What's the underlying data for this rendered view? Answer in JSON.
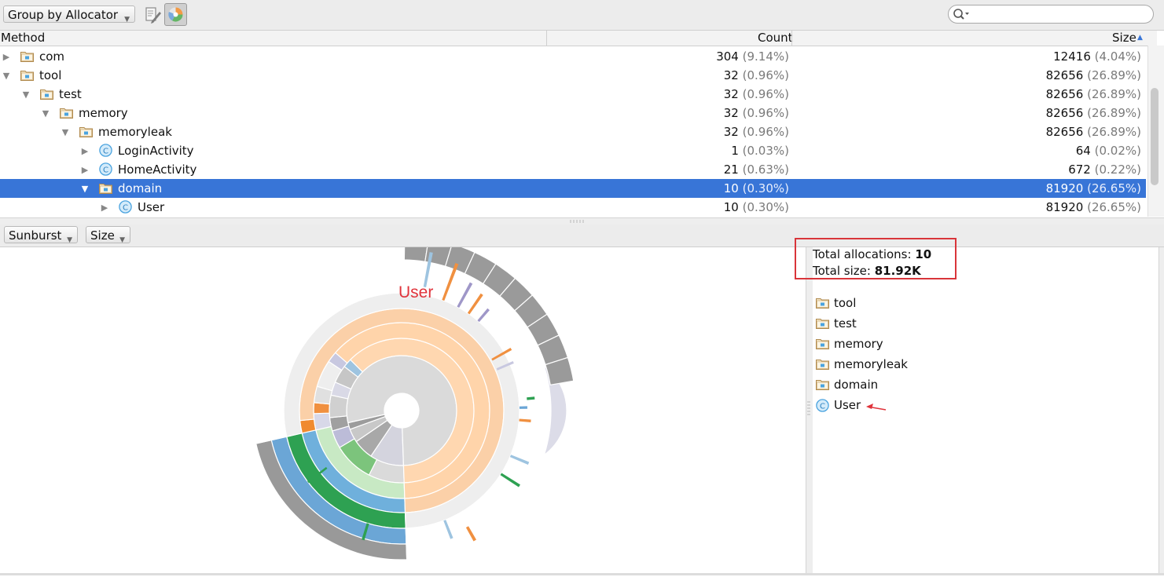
{
  "toolbar": {
    "group_by": "Group by Allocator",
    "edit_icon": "edit-filter-icon",
    "chart_toggle_icon": "pie-chart-icon",
    "search_placeholder": "",
    "search_icon": "search-icon"
  },
  "table": {
    "columns": [
      "Method",
      "Count",
      "Size"
    ],
    "sort_indicator": "▲",
    "rows": [
      {
        "name": "com",
        "type": "package",
        "expanded": false,
        "depth": 0,
        "count": "304",
        "count_pct": "(9.14%)",
        "size": "12416",
        "size_pct": "(4.04%)"
      },
      {
        "name": "tool",
        "type": "package",
        "expanded": true,
        "depth": 0,
        "count": "32",
        "count_pct": "(0.96%)",
        "size": "82656",
        "size_pct": "(26.89%)"
      },
      {
        "name": "test",
        "type": "package",
        "expanded": true,
        "depth": 1,
        "count": "32",
        "count_pct": "(0.96%)",
        "size": "82656",
        "size_pct": "(26.89%)"
      },
      {
        "name": "memory",
        "type": "package",
        "expanded": true,
        "depth": 2,
        "count": "32",
        "count_pct": "(0.96%)",
        "size": "82656",
        "size_pct": "(26.89%)"
      },
      {
        "name": "memoryleak",
        "type": "package",
        "expanded": true,
        "depth": 3,
        "count": "32",
        "count_pct": "(0.96%)",
        "size": "82656",
        "size_pct": "(26.89%)"
      },
      {
        "name": "LoginActivity",
        "type": "class",
        "expanded": false,
        "depth": 4,
        "count": "1",
        "count_pct": "(0.03%)",
        "size": "64",
        "size_pct": "(0.02%)"
      },
      {
        "name": "HomeActivity",
        "type": "class",
        "expanded": false,
        "depth": 4,
        "count": "21",
        "count_pct": "(0.63%)",
        "size": "672",
        "size_pct": "(0.22%)"
      },
      {
        "name": "domain",
        "type": "package",
        "expanded": true,
        "depth": 4,
        "count": "10",
        "count_pct": "(0.30%)",
        "size": "81920",
        "size_pct": "(26.65%)",
        "selected": true
      },
      {
        "name": "User",
        "type": "class",
        "expanded": false,
        "depth": 5,
        "count": "10",
        "count_pct": "(0.30%)",
        "size": "81920",
        "size_pct": "(26.65%)"
      }
    ]
  },
  "chart_toolbar": {
    "chart_type": "Sunburst",
    "metric": "Size"
  },
  "sunburst": {
    "hover_label": "User",
    "rings": [
      {
        "segments": [
          {
            "value": 100,
            "color": "#dcdce8"
          }
        ]
      },
      {
        "segments": [
          {
            "value": 10,
            "color": "#d4d4de"
          },
          {
            "value": 6,
            "color": "#a8a8a8"
          },
          {
            "value": 4,
            "color": "#c8c8c8"
          },
          {
            "value": 2,
            "color": "#9c9c9c"
          },
          {
            "value": 78,
            "color": "#dadada"
          }
        ]
      },
      {
        "segments": [
          {
            "value": 8,
            "color": "#dadada"
          },
          {
            "value": 9,
            "color": "#7cc47c"
          },
          {
            "value": 4,
            "color": "#bcbcd8"
          },
          {
            "value": 3,
            "color": "#a0a0a0"
          },
          {
            "value": 5,
            "color": "#d0d0d0"
          },
          {
            "value": 3,
            "color": "#d9d9e6"
          },
          {
            "value": 4,
            "color": "#c6c6c6"
          },
          {
            "value": 2,
            "color": "#9ec4e0"
          },
          {
            "value": 62,
            "color": "#ffd7b0"
          }
        ]
      },
      {
        "segments": [
          {
            "value": 22,
            "color": "#c8e9c4"
          },
          {
            "value": 3,
            "color": "#d8d8e8"
          },
          {
            "value": 2,
            "color": "#f09040"
          },
          {
            "value": 3,
            "color": "#e0e0e0"
          },
          {
            "value": 5,
            "color": "#eeeeee"
          },
          {
            "value": 2,
            "color": "#c8c8e0"
          },
          {
            "value": 63,
            "color": "#ffd4aa"
          }
        ]
      },
      {
        "segments": [
          {
            "value": 22,
            "color": "#6fb0dc"
          },
          {
            "value": 2,
            "color": "#f08a30"
          },
          {
            "value": 76,
            "color": "#fbd0a8"
          }
        ]
      },
      {
        "segments": [
          {
            "value": 22,
            "color": "#2ea152"
          },
          {
            "value": 78,
            "color": "#eeeeee"
          }
        ]
      },
      {
        "segments": [
          {
            "value": 22,
            "color": "#6ba6d6"
          },
          {
            "value": 78,
            "color": "#ffffff"
          }
        ]
      },
      {
        "segments": [
          {
            "value": 22,
            "color": "#999999"
          },
          {
            "value": 78,
            "color": "#ffffff"
          }
        ]
      }
    ]
  },
  "info": {
    "total_allocations_label": "Total allocations:",
    "total_allocations_value": "10",
    "total_size_label": "Total size:",
    "total_size_value": "81.92K",
    "path": [
      {
        "name": "tool",
        "type": "package"
      },
      {
        "name": "test",
        "type": "package"
      },
      {
        "name": "memory",
        "type": "package"
      },
      {
        "name": "memoryleak",
        "type": "package"
      },
      {
        "name": "domain",
        "type": "package"
      },
      {
        "name": "User",
        "type": "class"
      }
    ]
  },
  "colors": {
    "selection": "#3875d7",
    "annotation_red": "#d9353a",
    "folder_tan": "#c9a46a",
    "class_blue": "#4aa3df"
  }
}
